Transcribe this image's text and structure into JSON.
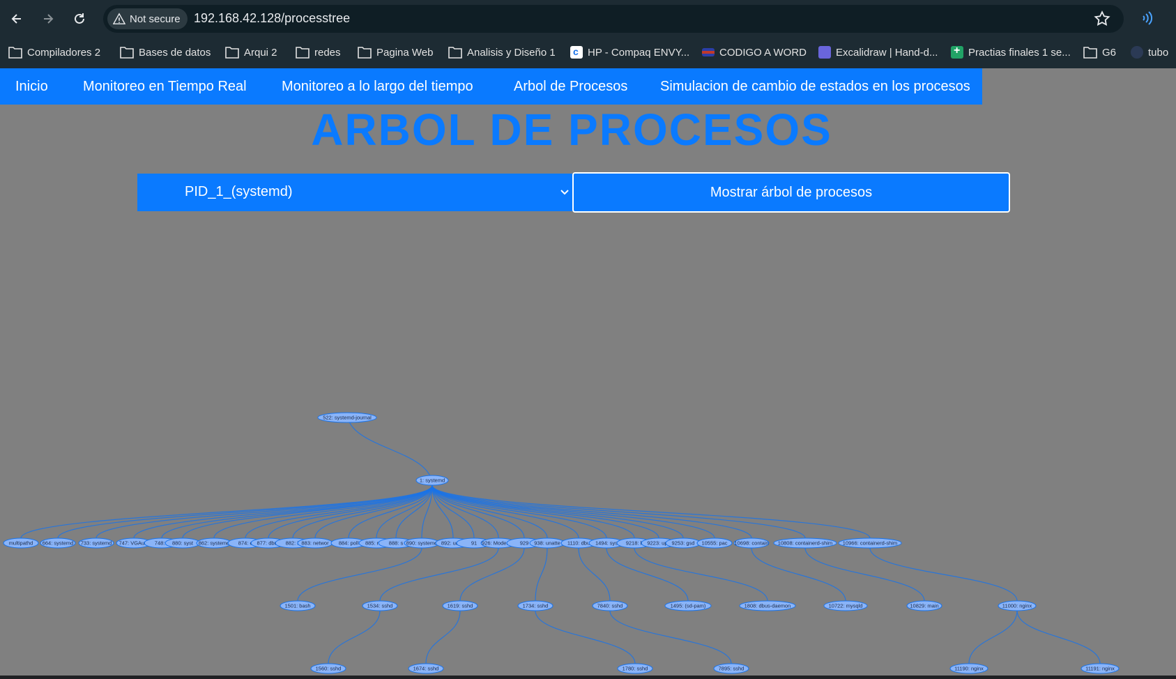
{
  "browser": {
    "security_label": "Not secure",
    "url": "192.168.42.128/processtree",
    "bookmarks": [
      {
        "label": "Compiladores 2",
        "icon": "folder-icon"
      },
      {
        "label": "Bases de datos",
        "icon": "folder-icon"
      },
      {
        "label": "Arqui 2",
        "icon": "folder-icon"
      },
      {
        "label": "redes",
        "icon": "folder-icon"
      },
      {
        "label": "Pagina Web",
        "icon": "folder-icon"
      },
      {
        "label": "Analisis y Diseño 1",
        "icon": "folder-icon"
      },
      {
        "label": "HP - Compaq ENVY...",
        "icon": "c-favicon"
      },
      {
        "label": "CODIGO A WORD",
        "icon": "flag-favicon"
      },
      {
        "label": "Excalidraw | Hand-d...",
        "icon": "excalidraw-favicon"
      },
      {
        "label": "Practias finales 1 se...",
        "icon": "sheets-favicon"
      },
      {
        "label": "G6",
        "icon": "folder-icon"
      },
      {
        "label": "tubo",
        "icon": "profile-favicon"
      }
    ]
  },
  "navbar": {
    "items": [
      "Inicio",
      "Monitoreo en Tiempo Real",
      "Monitoreo a lo largo del tiempo",
      "Arbol de Procesos",
      "Simulacion de cambio de estados en los procesos"
    ]
  },
  "page": {
    "title": "ARBOL DE PROCESOS",
    "selected_pid": "PID_1_(systemd)",
    "show_button": "Mostrar árbol de procesos"
  },
  "colors": {
    "accent": "#0a7aff",
    "background": "#808080",
    "node_fill": "#8ab4f8",
    "edge": "#1a73e8"
  },
  "tree": {
    "root": {
      "id": "1",
      "label": "1: systemd"
    },
    "nodes": [
      {
        "id": "522",
        "label": "522: systemd-journal",
        "parent": "1"
      },
      {
        "id": "mp",
        "label": "multipathd",
        "parent": "1"
      },
      {
        "id": "664",
        "label": "664: systemd",
        "parent": "1"
      },
      {
        "id": "733",
        "label": "733: systemd",
        "parent": "1"
      },
      {
        "id": "747",
        "label": "747: VGAuth",
        "parent": "1"
      },
      {
        "id": "748",
        "label": "748: v",
        "parent": "1"
      },
      {
        "id": "880",
        "label": "880: syst",
        "parent": "1"
      },
      {
        "id": "862",
        "label": "862: systemd",
        "parent": "1"
      },
      {
        "id": "874",
        "label": "874: c",
        "parent": "1"
      },
      {
        "id": "877",
        "label": "877: dbus",
        "parent": "1"
      },
      {
        "id": "882",
        "label": "882: ir",
        "parent": "1"
      },
      {
        "id": "883",
        "label": "883: networ",
        "parent": "1"
      },
      {
        "id": "884",
        "label": "884: poll",
        "parent": "1"
      },
      {
        "id": "885",
        "label": "885: rsysl",
        "parent": "1"
      },
      {
        "id": "888",
        "label": "888: s",
        "parent": "1"
      },
      {
        "id": "890",
        "label": "890: systemd",
        "parent": "1"
      },
      {
        "id": "892",
        "label": "892: udisk",
        "parent": "1"
      },
      {
        "id": "91x",
        "label": "91",
        "parent": "1"
      },
      {
        "id": "926",
        "label": "926: ModemM",
        "parent": "1"
      },
      {
        "id": "929",
        "label": "929",
        "parent": "1"
      },
      {
        "id": "938",
        "label": "938: unatte",
        "parent": "1"
      },
      {
        "id": "1110",
        "label": "1110: dbu",
        "parent": "1"
      },
      {
        "id": "1494",
        "label": "1494: sys",
        "parent": "1"
      },
      {
        "id": "9218",
        "label": "9218: k",
        "parent": "1"
      },
      {
        "id": "9223",
        "label": "9223: upo",
        "parent": "1"
      },
      {
        "id": "9253",
        "label": "9253: gsd",
        "parent": "1"
      },
      {
        "id": "10555",
        "label": "10555: pac",
        "parent": "1"
      },
      {
        "id": "10698",
        "label": "10698: contain",
        "parent": "1"
      },
      {
        "id": "10808",
        "label": "10808: containerd-shim",
        "parent": "1"
      },
      {
        "id": "10966",
        "label": "10966: containerd-shim",
        "parent": "1"
      },
      {
        "id": "1501",
        "label": "1501: bash",
        "parent": "890"
      },
      {
        "id": "1534",
        "label": "1534: sshd",
        "parent": "926"
      },
      {
        "id": "1619",
        "label": "1619: sshd",
        "parent": "929"
      },
      {
        "id": "1734",
        "label": "1734: sshd",
        "parent": "938"
      },
      {
        "id": "7840",
        "label": "7840: sshd",
        "parent": "1110"
      },
      {
        "id": "1495",
        "label": "1495: (sd-pam)",
        "parent": "1494"
      },
      {
        "id": "1808",
        "label": "1808: dbus-daemon",
        "parent": "9218"
      },
      {
        "id": "10722",
        "label": "10722: mysqld",
        "parent": "10698"
      },
      {
        "id": "10829",
        "label": "10829: main",
        "parent": "10808"
      },
      {
        "id": "11000",
        "label": "11000: nginx",
        "parent": "10966"
      },
      {
        "id": "1560",
        "label": "1560: sshd",
        "parent": "1534"
      },
      {
        "id": "1674",
        "label": "1674: sshd",
        "parent": "1619"
      },
      {
        "id": "1780",
        "label": "1780: sshd",
        "parent": "1734"
      },
      {
        "id": "7895",
        "label": "7895: sshd",
        "parent": "7840"
      },
      {
        "id": "11190",
        "label": "11190: nginx",
        "parent": "11000"
      },
      {
        "id": "11191",
        "label": "11191: nginx",
        "parent": "11000"
      }
    ]
  }
}
